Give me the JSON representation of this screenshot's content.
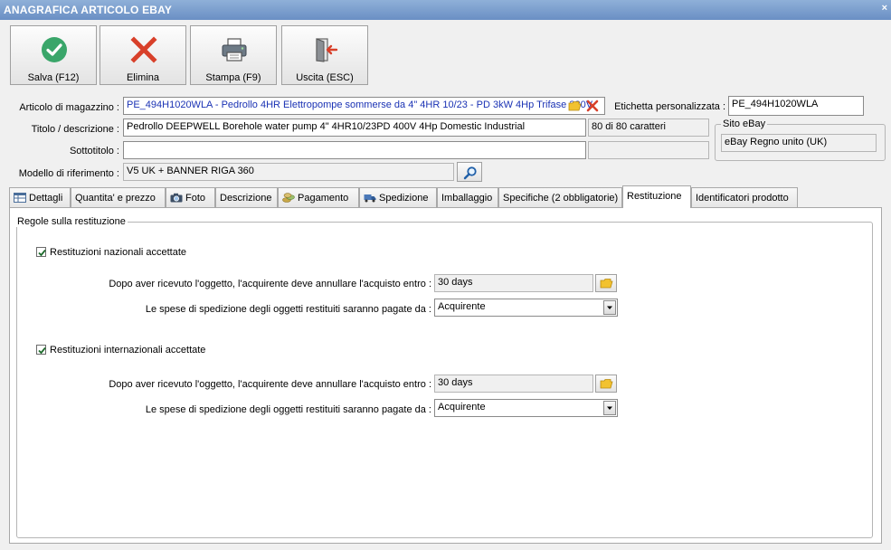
{
  "window": {
    "title": "ANAGRAFICA ARTICOLO EBAY",
    "close_glyph": "×"
  },
  "toolbar": {
    "save_label": "Salva (F12)",
    "delete_label": "Elimina",
    "print_label": "Stampa (F9)",
    "exit_label": "Uscita (ESC)"
  },
  "form": {
    "articolo_label": "Articolo di magazzino :",
    "articolo_value": "PE_494H1020WLA - Pedrollo 4HR Elettropompe sommerse da 4\" 4HR 10/23 - PD 3kW 4Hp Trifase 380V",
    "etichetta_label": "Etichetta personalizzata :",
    "etichetta_value": "PE_494H1020WLA",
    "titolo_label": "Titolo / descrizione :",
    "titolo_value": "Pedrollo DEEPWELL Borehole water pump 4\" 4HR10/23PD 400V 4Hp Domestic Industrial",
    "char_count": "80 di 80 caratteri",
    "sottotitolo_label": "Sottotitolo :",
    "sottotitolo_value": "",
    "modello_label": "Modello di riferimento :",
    "modello_value": "V5 UK + BANNER RIGA 360",
    "sito_caption": "Sito eBay",
    "sito_value": "eBay Regno unito (UK)"
  },
  "tabs": [
    {
      "label": "Dettagli"
    },
    {
      "label": "Quantita' e prezzo"
    },
    {
      "label": "Foto"
    },
    {
      "label": "Descrizione"
    },
    {
      "label": "Pagamento"
    },
    {
      "label": "Spedizione"
    },
    {
      "label": "Imballaggio"
    },
    {
      "label": "Specifiche (2 obbligatorie)"
    },
    {
      "label": "Restituzione"
    },
    {
      "label": "Identificatori prodotto"
    }
  ],
  "active_tab": "Restituzione",
  "returns": {
    "group_caption": "Regole sulla restituzione",
    "national": {
      "checkbox_label": "Restituzioni nazionali accettate",
      "checked": true,
      "period_label": "Dopo aver ricevuto l'oggetto, l'acquirente deve annullare l'acquisto entro :",
      "period_value": "30 days",
      "shipping_label": "Le spese di spedizione degli oggetti restituiti saranno pagate da :",
      "shipping_value": "Acquirente"
    },
    "international": {
      "checkbox_label": "Restituzioni internazionali accettate",
      "checked": true,
      "period_label": "Dopo aver ricevuto l'oggetto, l'acquirente deve annullare l'acquisto entro :",
      "period_value": "30 days",
      "shipping_label": "Le spese di spedizione degli oggetti restituiti saranno pagate da :",
      "shipping_value": "Acquirente"
    }
  },
  "colors": {
    "save_icon": "#3aa66a",
    "delete_icon": "#d8402a",
    "link_text": "#1a32b4",
    "folder_icon": "#f2c230"
  }
}
